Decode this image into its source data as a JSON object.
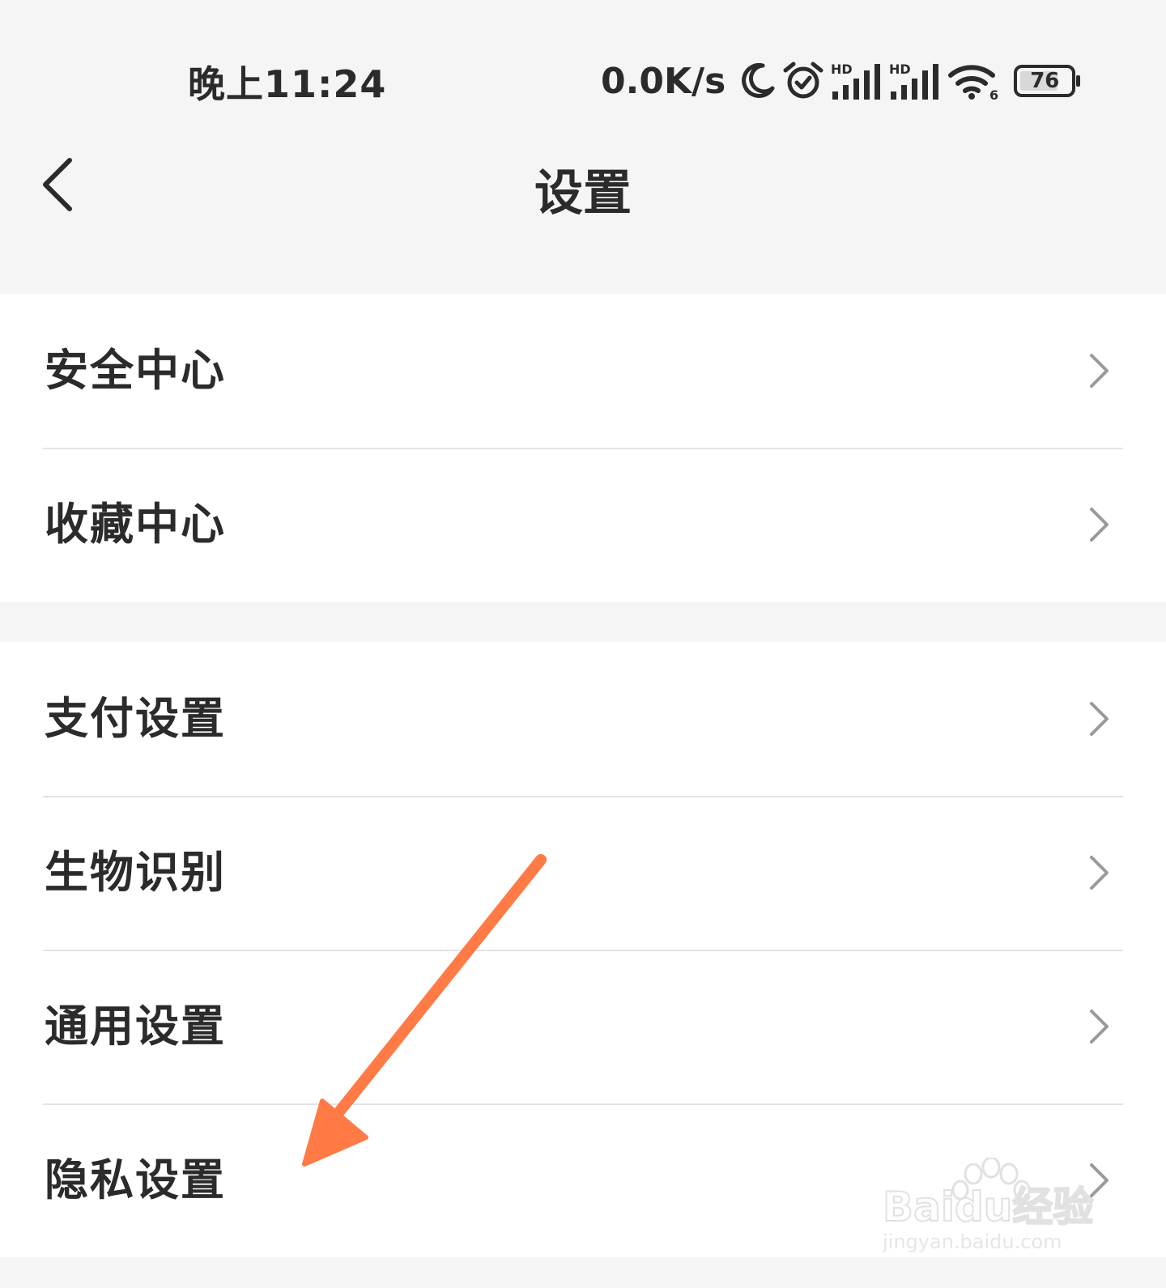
{
  "status_bar": {
    "time": "晚上11:24",
    "net_speed": "0.0K/s",
    "icons": [
      "moon-icon",
      "alarm-icon",
      "hd-signal-icon",
      "hd-signal-icon",
      "wifi-icon"
    ],
    "wifi_badge": "6",
    "signal_badge": "HD",
    "battery_level": "76"
  },
  "nav": {
    "title": "设置",
    "back_icon": "chevron-left-icon"
  },
  "groups": [
    {
      "items": [
        {
          "label": "安全中心"
        },
        {
          "label": "收藏中心"
        }
      ]
    },
    {
      "items": [
        {
          "label": "支付设置"
        },
        {
          "label": "生物识别"
        },
        {
          "label": "通用设置"
        },
        {
          "label": "隐私设置"
        }
      ]
    }
  ],
  "annotation": {
    "type": "arrow",
    "color": "#ff7a45",
    "target": "隐私设置"
  },
  "watermark": {
    "brand": "Baidu经验",
    "url": "jingyan.baidu.com"
  },
  "colors": {
    "background": "#f5f5f5",
    "surface": "#ffffff",
    "text": "#2b2b2b",
    "divider": "#e3e3e3",
    "chevron": "#999999"
  }
}
